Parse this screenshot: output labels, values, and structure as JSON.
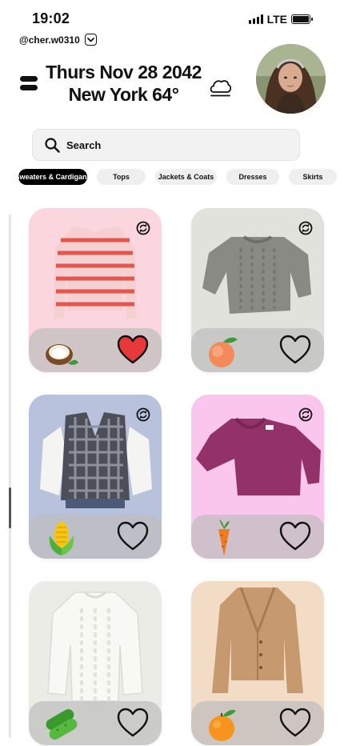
{
  "status": {
    "time": "19:02",
    "network": "LTE"
  },
  "user": {
    "handle": "@cher.w0310"
  },
  "header": {
    "date": "Thurs Nov 28 2042",
    "weather": "New York 64°",
    "weather_icon": "cloud-icon"
  },
  "search": {
    "label": "Search",
    "icon": "search-icon"
  },
  "categories": [
    {
      "label": "Sweaters & Cardigans",
      "active": true
    },
    {
      "label": "Tops",
      "active": false
    },
    {
      "label": "Jackets & Coats",
      "active": false
    },
    {
      "label": "Dresses",
      "active": false
    },
    {
      "label": "Skirts",
      "active": false
    },
    {
      "label": "",
      "active": false
    }
  ],
  "items": [
    {
      "item": "pink striped sweater",
      "background": "#fcd6df",
      "tag_icon": "coconut-icon",
      "liked": true,
      "restyle_icon": true
    },
    {
      "item": "grey cable-knit sweater",
      "background": "#e2e2dd",
      "tag_icon": "peach-icon",
      "liked": false,
      "restyle_icon": true
    },
    {
      "item": "plaid sweater vest over white shirt",
      "background": "#b9c2dc",
      "tag_icon": "corn-icon",
      "liked": false,
      "restyle_icon": true
    },
    {
      "item": "magenta cardigan",
      "background": "#fbc6ee",
      "tag_icon": "carrot-icon",
      "liked": false,
      "restyle_icon": true
    },
    {
      "item": "cream cable-knit sweater",
      "background": "#ecece7",
      "tag_icon": "cucumber-icon",
      "liked": false,
      "restyle_icon": false
    },
    {
      "item": "camel v-neck cardigan",
      "background": "#f3dcc6",
      "tag_icon": "orange-icon",
      "liked": false,
      "restyle_icon": false
    }
  ],
  "colors": {
    "accent": "#000000",
    "liked_heart": "#e8393a",
    "chip_bg": "#efefef",
    "search_bg": "#f2f2f2"
  }
}
